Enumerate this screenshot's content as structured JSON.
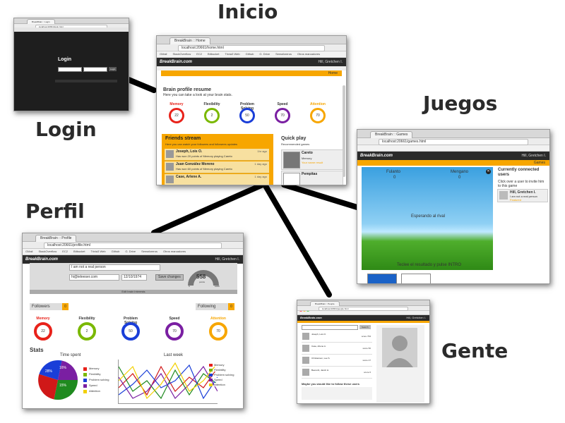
{
  "labels": {
    "inicio": "Inicio",
    "login": "Login",
    "juegos": "Juegos",
    "perfil": "Perfil",
    "gente": "Gente"
  },
  "colors": {
    "connector": "#000000",
    "label": "#2b2b2b",
    "app_dark": "#2a2a2a",
    "app_orange": "#f7a600",
    "memory": "#e8221a",
    "flexibility": "#7ab800",
    "problem_solving": "#1a3ed8",
    "speed": "#7a1fa2",
    "attention": "#f7a600"
  },
  "login_shot": {
    "tab": "BreakBrain :: Login",
    "url": "localhost:20661/login.html",
    "heading": "Login",
    "button": "Login"
  },
  "home_shot": {
    "tab": "BreakBrain :: Home",
    "url": "localhost:20661/home.html",
    "bookmarks": [
      "GMail",
      "StackOverflow",
      "EC2",
      "Bitbucket",
      "Trivia3 Web",
      "Github",
      "G. Drive",
      "Semaforeros",
      "Otros marcadores"
    ],
    "logo": "BreakBrain.com",
    "user": "Hill, Gretchen I.",
    "crumb": "Home",
    "resume_title": "Brain profile resume",
    "resume_sub": "Here you can take a look at your brain stats.",
    "stats": [
      {
        "name": "Memory",
        "value": "22"
      },
      {
        "name": "Flexibility",
        "value": "2"
      },
      {
        "name": "Problem Solving",
        "value": "50"
      },
      {
        "name": "Speed",
        "value": "70"
      },
      {
        "name": "Attention",
        "value": "70"
      }
    ],
    "friends_title": "Friends stream",
    "friends_sub": "Here you can watch your followers and followees updates",
    "friends": [
      {
        "name": "Joseph, Lois O.",
        "text": "Has won 20 points of Memory playing Careto",
        "when": "1hr ago"
      },
      {
        "name": "Juan González Moreno",
        "text": "Has won 60 points of Memory playing Careto",
        "when": "1 day ago"
      },
      {
        "name": "Case, Arlene A.",
        "text": "",
        "when": "1 day ago"
      }
    ],
    "quick_title": "Quick play",
    "quick_sub": "Recommended games",
    "games": [
      {
        "name": "Careto",
        "tag": "Memory",
        "note": "Your name result"
      },
      {
        "name": "Pempitas",
        "tag": "",
        "note": ""
      }
    ]
  },
  "games_shot": {
    "tab": "BreakBrain :: Games",
    "url": "localhost:20661/games.html",
    "logo": "BreakBrain.com",
    "user": "Hill, Gretchen I.",
    "crumb": "Games",
    "player1": "Fulanto",
    "score1": "0",
    "player2": "Mengano",
    "score2": "0",
    "waiting": "Esperando al rival",
    "hint": "Teclee el resultado y pulse INTRO",
    "side_title": "Currently connected users",
    "side_sub": "Click over a user to invite him to this game",
    "side_user": "Hill, Gretchen I.",
    "side_user_note": "I am not a real person",
    "side_user_status": "Featured"
  },
  "profile_shot": {
    "tab": "BreakBrain :: Profile",
    "url": "localhost:20661/profile.html",
    "bookmarks": [
      "GMail",
      "StackOverflow",
      "EC2",
      "Bitbucket",
      "Trivia3 Web",
      "Github",
      "G. Drive",
      "Semaforeros",
      "Otros marcadores"
    ],
    "logo": "BreakBrain.com",
    "user": "Hill, Gretchen I.",
    "bio": "I am not a real person",
    "email": "hi@ieleeser.com",
    "date": "12/10/1974",
    "save": "Save changes",
    "gauge_value": "558",
    "gauge_unit": "points",
    "gauge_min": "0",
    "gauge_max": "1000",
    "edit_link": "Edit brain interests",
    "followers_label": "Followers",
    "followers_count": "0",
    "following_label": "Following",
    "following_count": "0",
    "stats": [
      {
        "name": "Memory",
        "value": "22"
      },
      {
        "name": "Flexibility",
        "value": "2"
      },
      {
        "name": "Problem Solving",
        "value": "50"
      },
      {
        "name": "Speed",
        "value": "70"
      },
      {
        "name": "Attention",
        "value": "70"
      }
    ],
    "stats_title": "Stats",
    "pie_title": "Time spent",
    "pie_labels": [
      "28%",
      "16%",
      "15%"
    ],
    "line_title": "Last week",
    "legend": [
      "Memory",
      "Flexibility",
      "Problem solving",
      "Speed",
      "Attention"
    ]
  },
  "people_shot": {
    "tab": "BreakBrain :: People",
    "url": "localhost:20661/people.html",
    "logo": "BreakBrain.com",
    "user": "Hill, Gretchen I.",
    "search_btn": "Search",
    "people": [
      {
        "name": "Joseph, Lois O.",
        "score": "score 793"
      },
      {
        "name": "Case, Arlene A.",
        "score": "score 50"
      },
      {
        "name": "Christensen, Lee S.",
        "score": "score 47"
      },
      {
        "name": "Beerenb, Jacob H.",
        "score": "score 6"
      }
    ],
    "suggest_title": "Maybe you would like to follow these users"
  }
}
